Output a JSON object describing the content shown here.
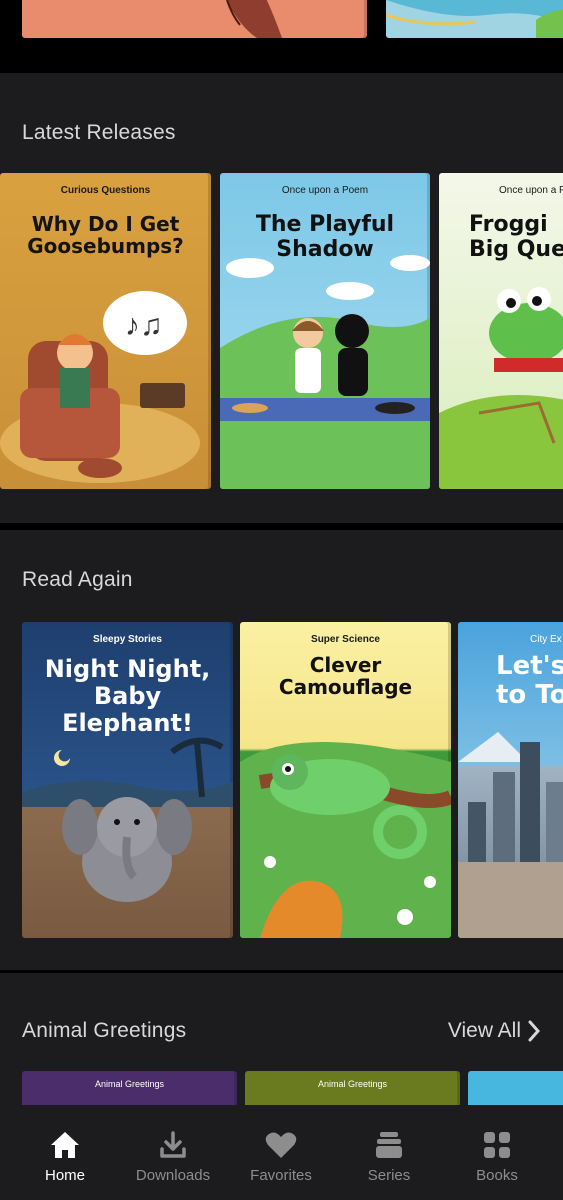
{
  "sections": {
    "latest": {
      "title": "Latest Releases"
    },
    "read_again": {
      "title": "Read Again"
    },
    "animal": {
      "title": "Animal Greetings",
      "view_all": "View All"
    }
  },
  "latest_books": [
    {
      "series": "Curious Questions",
      "title": "Why Do I Get Goosebumps?"
    },
    {
      "series": "Once upon a Poem",
      "title": "The Playful Shadow"
    },
    {
      "series": "Once upon a P",
      "title": "Froggi Big Que"
    }
  ],
  "read_again_books": [
    {
      "series": "Sleepy Stories",
      "title": "Night Night, Baby Elephant!"
    },
    {
      "series": "Super Science",
      "title": "Clever Camouflage"
    },
    {
      "series": "City Ex",
      "title": "Let's to To"
    }
  ],
  "animal_books": [
    {
      "series": "Animal Greetings"
    },
    {
      "series": "Animal Greetings"
    }
  ],
  "nav": {
    "home": "Home",
    "downloads": "Downloads",
    "favorites": "Favorites",
    "series": "Series",
    "books": "Books"
  },
  "colors": {
    "background": "#000000",
    "section": "#1c1c1e",
    "active": "#ffffff",
    "inactive": "#8d8d8d"
  }
}
